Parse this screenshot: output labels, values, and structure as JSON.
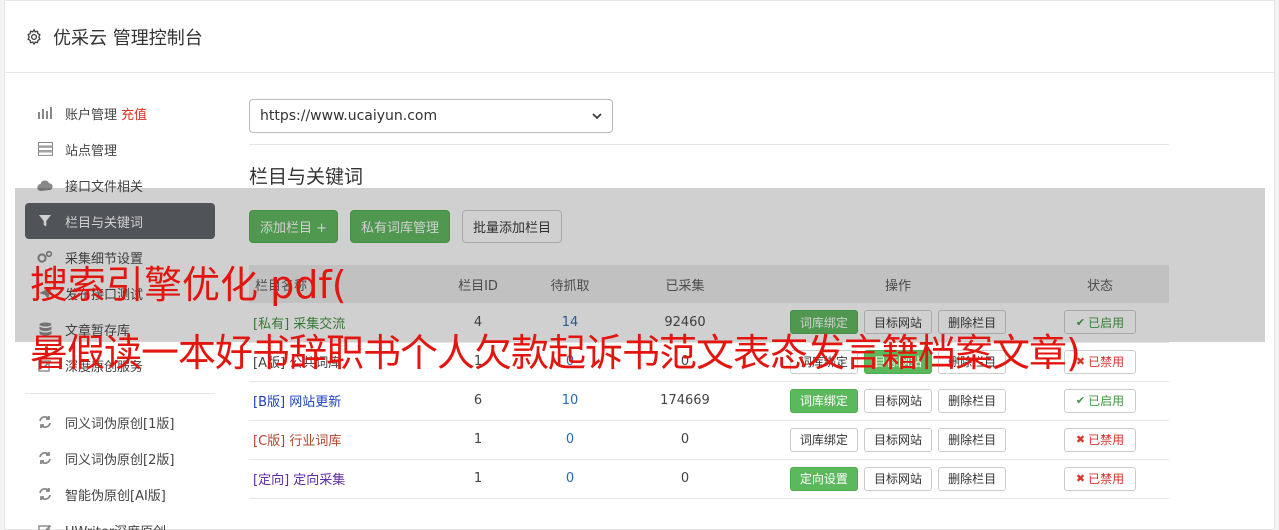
{
  "header": {
    "title": "优采云 管理控制台",
    "icon": "gear-icon"
  },
  "sidebar": {
    "group1": [
      {
        "label": "账户管理",
        "accent": "充值",
        "icon": "bar-chart-icon"
      },
      {
        "label": "站点管理",
        "icon": "server-icon"
      },
      {
        "label": "接口文件相关",
        "icon": "cloud-upload-icon"
      },
      {
        "label": "栏目与关键词",
        "icon": "filter-icon",
        "active": true
      },
      {
        "label": "采集细节设置",
        "icon": "cogs-icon"
      },
      {
        "label": "发布接口测试",
        "icon": "send-icon"
      },
      {
        "label": "文章暂存库",
        "icon": "database-icon"
      },
      {
        "label": "深度原创服务",
        "icon": "edit-icon"
      }
    ],
    "group2": [
      {
        "label": "同义词伪原创[1版]",
        "icon": "refresh-icon"
      },
      {
        "label": "同义词伪原创[2版]",
        "icon": "refresh-icon"
      },
      {
        "label": "智能伪原创[AI版]",
        "icon": "refresh-icon"
      },
      {
        "label": "UWriter深度原创",
        "icon": "pencil-icon"
      }
    ]
  },
  "main": {
    "site_select": "https://www.ucaiyun.com",
    "section_title": "栏目与关键词",
    "toolbar": {
      "add_column": "添加栏目 +",
      "private_lib": "私有词库管理",
      "batch_add": "批量添加栏目"
    },
    "table": {
      "headers": {
        "name": "栏目名称",
        "id": "栏目ID",
        "waiting": "待抓取",
        "collected": "已采集",
        "ops": "操作",
        "status": "状态"
      },
      "rows": [
        {
          "tag": "[私有]",
          "name": "采集交流",
          "id": "4",
          "waiting": "14",
          "collected": "92460",
          "op1": "词库绑定",
          "op2": "目标网站",
          "op3": "删除栏目",
          "status": "已启用"
        },
        {
          "tag": "[A版]",
          "name": "公共词库",
          "id": "1",
          "waiting": "0",
          "collected": "0",
          "op1": "词库绑定",
          "op2": "目标网站",
          "op3": "删除栏目",
          "status": "已禁用"
        },
        {
          "tag": "[B版]",
          "name": "网站更新",
          "id": "6",
          "waiting": "10",
          "collected": "174669",
          "op1": "词库绑定",
          "op2": "目标网站",
          "op3": "删除栏目",
          "status": "已启用"
        },
        {
          "tag": "[C版]",
          "name": "行业词库",
          "id": "1",
          "waiting": "0",
          "collected": "0",
          "op1": "词库绑定",
          "op2": "目标网站",
          "op3": "删除栏目",
          "status": "已禁用"
        },
        {
          "tag": "[定向]",
          "name": "定向采集",
          "id": "1",
          "waiting": "0",
          "collected": "0",
          "op1": "定向设置",
          "op2": "目标网站",
          "op3": "删除栏目",
          "status": "已禁用"
        }
      ]
    }
  },
  "watermark": {
    "line1": "搜索引擎优化 pdf(",
    "line2": "暑假读一本好书辞职书个人欠款起诉书范文表态发言籍档案文章)"
  },
  "colors": {
    "green": "#5cb85c",
    "red_text": "#e3150f",
    "active_nav": "#5c5f66"
  }
}
